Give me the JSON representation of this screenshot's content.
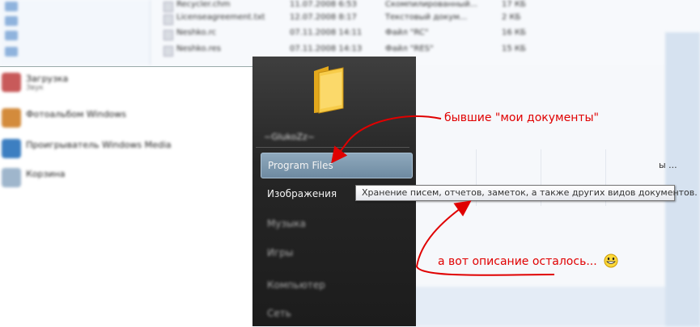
{
  "explorer": {
    "files": [
      {
        "name": "Recycler.chm",
        "date": "11.07.2008 6:53",
        "type": "Скомпилированный...",
        "size": "17 КБ"
      },
      {
        "name": "Licenseagreement.txt",
        "date": "12.07.2008 8:17",
        "type": "Текстовый докум...",
        "size": "2 КБ"
      },
      {
        "name": "Neshko.rc",
        "date": "07.11.2008 14:11",
        "type": "Файл \"RC\"",
        "size": "16 КБ"
      },
      {
        "name": "Neshko.res",
        "date": "07.11.2008 14:13",
        "type": "Файл \"RES\"",
        "size": "15 КБ"
      }
    ],
    "partial_label": "ы ..."
  },
  "start_menu": {
    "programs": [
      {
        "label": "Загрузка",
        "sub": "Звук",
        "color": "#c85a5a"
      },
      {
        "label": "Фотоальбом Windows",
        "sub": "",
        "color": "#d38b3c"
      },
      {
        "label": "Проигрыватель Windows Media",
        "sub": "",
        "color": "#3d7fc1"
      },
      {
        "label": "Корзина",
        "sub": "",
        "color": "#9fb6cc"
      }
    ],
    "user": "~GlukoZz~",
    "right_items": [
      {
        "label": "Program Files",
        "selected": true
      },
      {
        "label": "Изображения",
        "selected": false
      },
      {
        "label": "Музыка",
        "selected": false
      },
      {
        "label": "Игры",
        "selected": false
      },
      {
        "label": "Компьютер",
        "selected": false
      },
      {
        "label": "Сеть",
        "selected": false
      }
    ],
    "tooltip": "Хранение писем, отчетов, заметок, а также других видов документов."
  },
  "annotations": {
    "former_docs": "бывшие \"мои документы\"",
    "description_left": "а вот описание осталось..."
  },
  "colors": {
    "annotation": "#e00000",
    "menu_dark": "#262626",
    "selected": "#7f9bb1"
  }
}
